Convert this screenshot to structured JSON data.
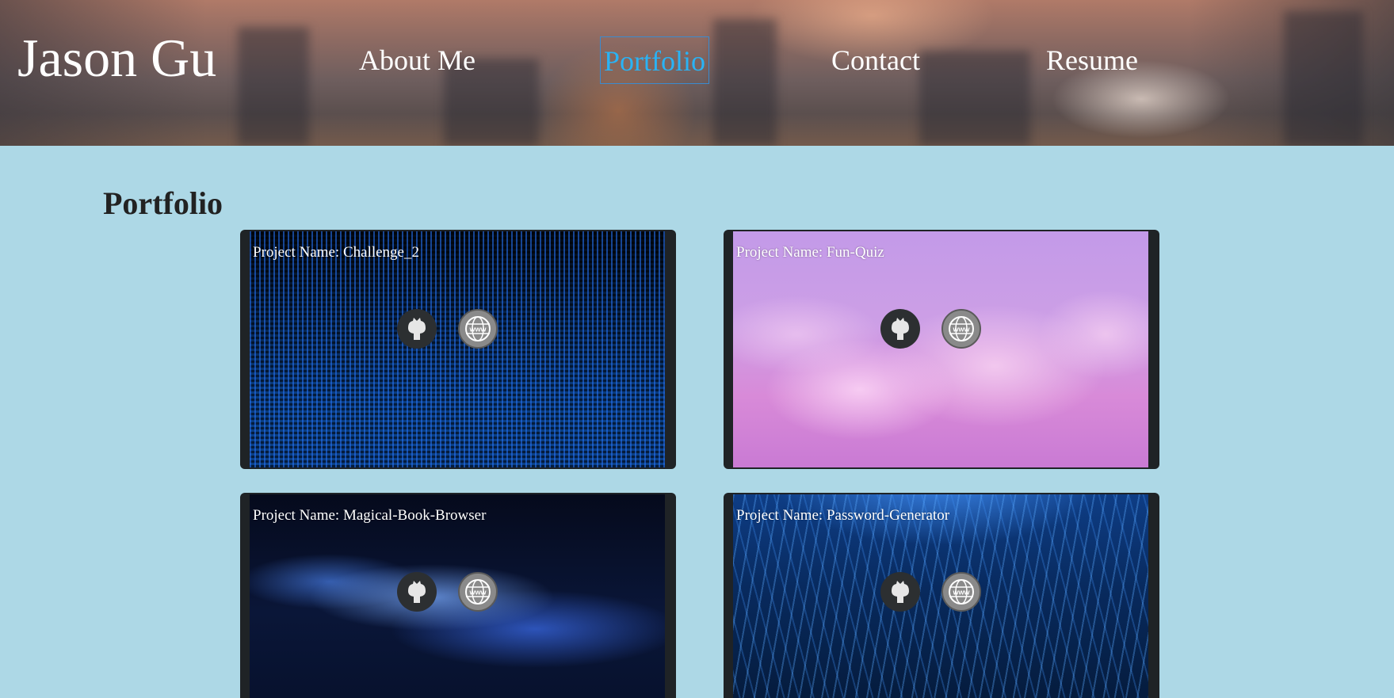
{
  "header": {
    "brand": "Jason Gu",
    "nav": [
      {
        "label": "About Me",
        "active": false
      },
      {
        "label": "Portfolio",
        "active": true
      },
      {
        "label": "Contact",
        "active": false
      },
      {
        "label": "Resume",
        "active": false
      }
    ],
    "active_color": "#29b3f5"
  },
  "portfolio": {
    "title": "Portfolio",
    "projects": [
      {
        "name": "Project Name: Challenge_2",
        "links": [
          "github-icon",
          "website-icon"
        ]
      },
      {
        "name": "Project Name: Fun-Quiz",
        "links": [
          "github-icon",
          "website-icon"
        ]
      },
      {
        "name": "Project Name: Magical-Book-Browser",
        "links": [
          "github-icon",
          "website-icon"
        ]
      },
      {
        "name": "Project Name: Password-Generator",
        "links": [
          "github-icon",
          "website-icon"
        ]
      }
    ]
  },
  "colors": {
    "page_background": "#add8e6",
    "card_frame": "#1f2326"
  }
}
